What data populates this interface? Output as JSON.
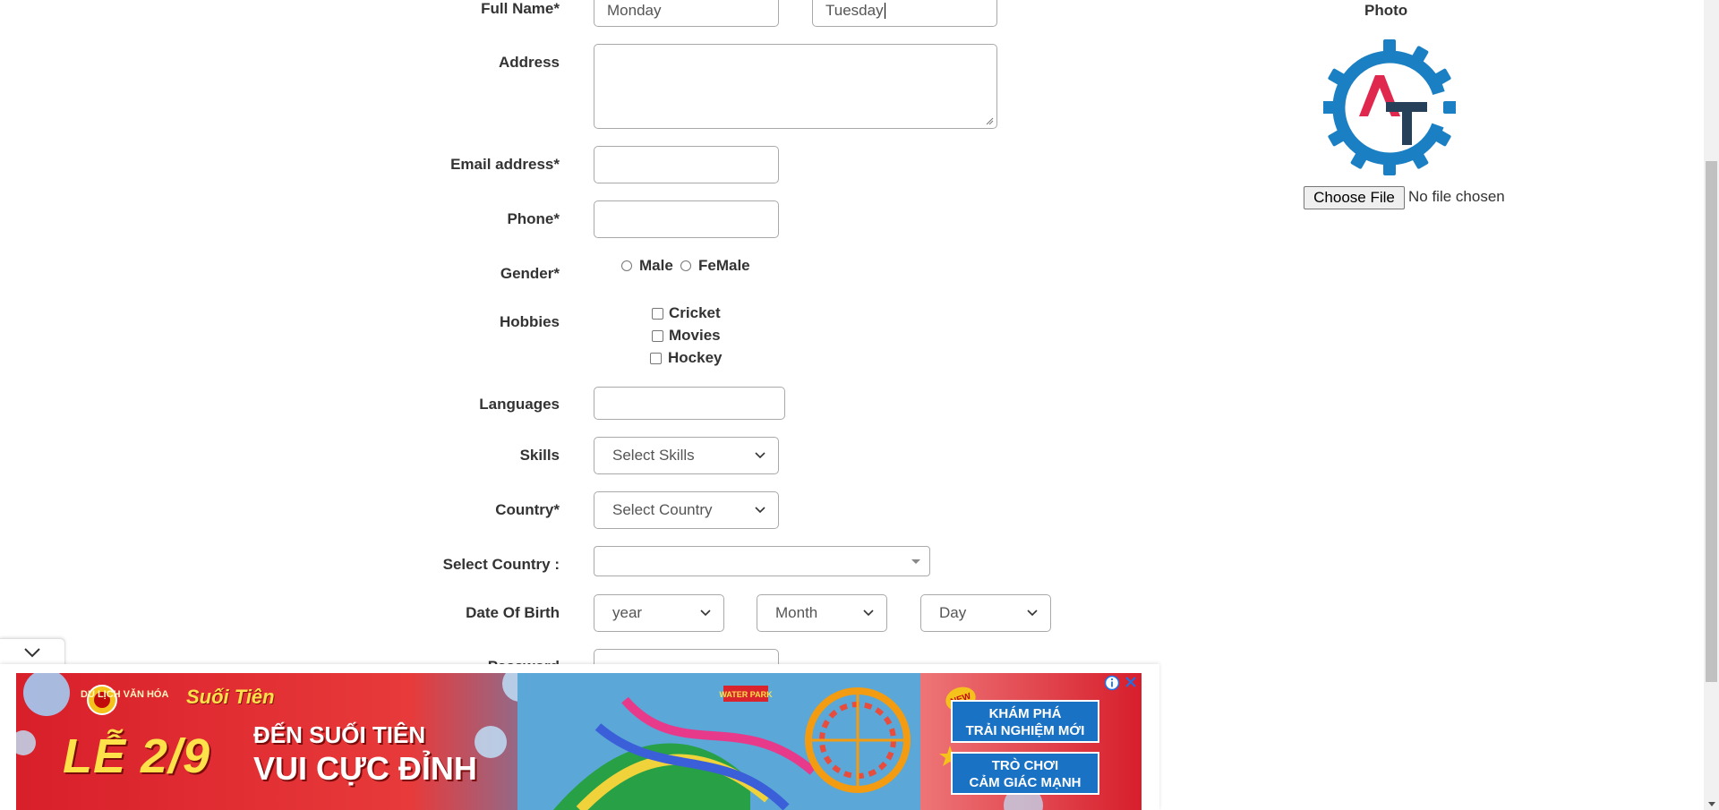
{
  "form": {
    "full_name": {
      "label": "Full Name*",
      "first_value": "Monday",
      "last_value": "Tuesday"
    },
    "address": {
      "label": "Address",
      "value": ""
    },
    "email": {
      "label": "Email address*",
      "value": ""
    },
    "phone": {
      "label": "Phone*",
      "value": ""
    },
    "gender": {
      "label": "Gender*",
      "options": [
        "Male",
        "FeMale"
      ]
    },
    "hobbies": {
      "label": "Hobbies",
      "options": [
        "Cricket",
        "Movies",
        "Hockey"
      ]
    },
    "languages": {
      "label": "Languages",
      "value": ""
    },
    "skills": {
      "label": "Skills",
      "selected": "Select Skills"
    },
    "country": {
      "label": "Country*",
      "selected": "Select Country"
    },
    "select_country": {
      "label": "Select Country :",
      "selected": ""
    },
    "date_of_birth": {
      "label": "Date Of Birth",
      "year": "year",
      "month": "Month",
      "day": "Day"
    },
    "password": {
      "label": "Password"
    }
  },
  "photo": {
    "title": "Photo",
    "choose_button": "Choose File",
    "status": "No file chosen",
    "logo_colors": {
      "gear": "#1b7fc4",
      "a": "#e0284f",
      "t": "#27405a"
    }
  },
  "ad": {
    "logo_text": "DU LỊCH VĂN HÓA",
    "brand": "Suối Tiên",
    "headline": "LỄ 2/9",
    "sub1": "ĐẾN SUỐI TIÊN",
    "sub2": "VUI CỰC ĐỈNH",
    "park_sign": "WATER PARK",
    "new_badge": "NEW",
    "box1_line1": "KHÁM PHÁ",
    "box1_line2": "TRẢI NGHIỆM MỚI",
    "box2_line1": "TRÒ CHƠI",
    "box2_line2": "CẢM GIÁC MẠNH"
  }
}
